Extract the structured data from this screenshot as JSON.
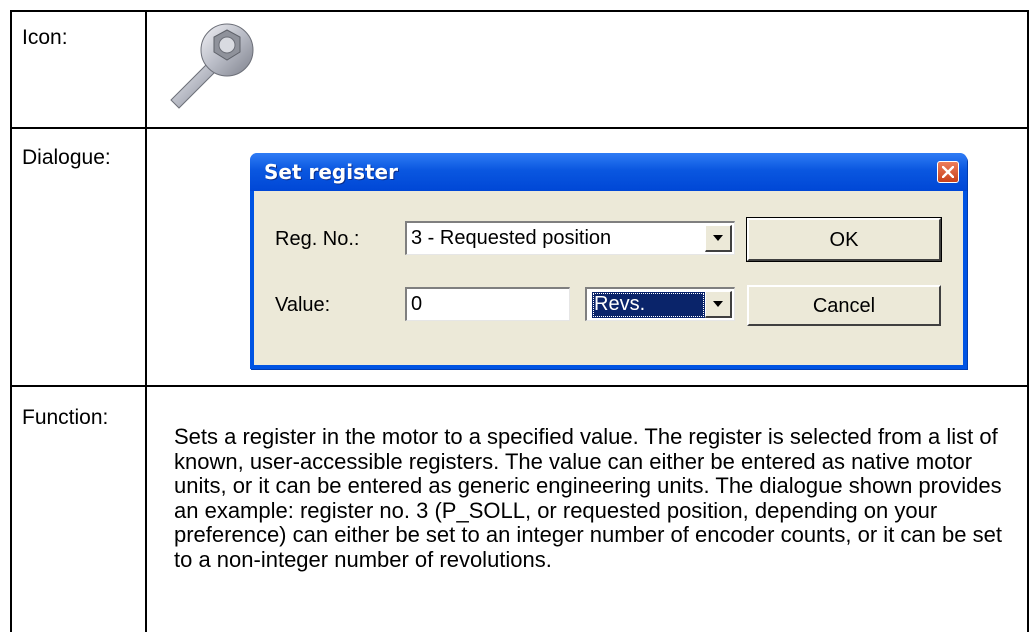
{
  "rows": {
    "icon_label": "Icon:",
    "dialogue_label": "Dialogue:",
    "function_label": "Function:"
  },
  "icon": {
    "name": "wrench-icon"
  },
  "dialog": {
    "title": "Set register",
    "reg_no_label": "Reg. No.:",
    "reg_no_value": "3 - Requested position",
    "value_label": "Value:",
    "value": "0",
    "unit_value": "Revs.",
    "ok_label": "OK",
    "cancel_label": "Cancel"
  },
  "function_text": "Sets a register in the motor to a specified value. The register is selected from a list of known, user-accessible registers. The value can either be entered as native motor units, or it can be entered as generic engineering units. The dialogue shown provides an example: register no. 3 (P_SOLL, or requested position, depending on your preference) can either be set to an integer number of encoder counts, or it can be set to a non-integer number of revolutions.",
  "colors": {
    "titlebar": "#0054e3",
    "dialog_face": "#ece9d8",
    "selection": "#0a246a",
    "close_button": "#c8401b"
  }
}
